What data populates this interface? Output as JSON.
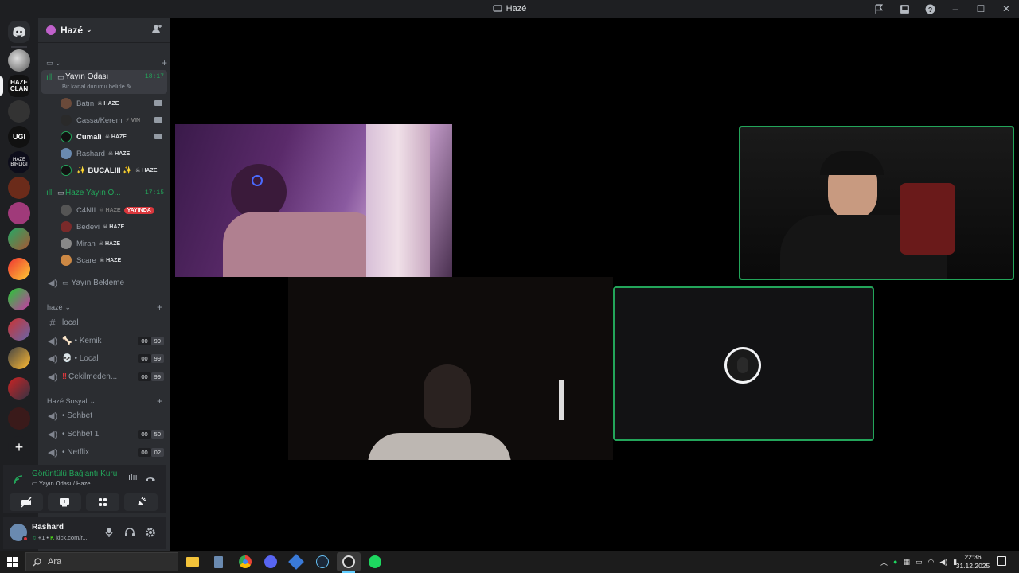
{
  "window": {
    "title": "Hazé"
  },
  "guild": {
    "name": "Hazé"
  },
  "channels": {
    "stream_room": {
      "name": "Yayın Odası",
      "status": "Bir kanal durumu belirle",
      "time": "18:17"
    },
    "members1": [
      {
        "name": "Batın",
        "tag": "HAZE"
      },
      {
        "name": "Cassa/Kerem",
        "tag": "VIN"
      },
      {
        "name": "Cumali",
        "tag": "HAZE"
      },
      {
        "name": "Rashard",
        "tag": "HAZE"
      },
      {
        "name": "✨ BUCALIII ✨",
        "tag": "HAZE"
      }
    ],
    "stream_room2": {
      "name": "Haze Yayın O...",
      "time": "17:15"
    },
    "members2": [
      {
        "name": "C4NII",
        "tag": "HAZE",
        "live": "YAYINDA"
      },
      {
        "name": "Bedevi",
        "tag": "HAZE"
      },
      {
        "name": "Miran",
        "tag": "HAZE"
      },
      {
        "name": "Scare",
        "tag": "HAZE"
      }
    ],
    "waiting": "Yayın Bekleme",
    "cat_haze": "hazé",
    "text_local": "local",
    "voice": [
      {
        "name": "• Kemik",
        "a": "00",
        "b": "99"
      },
      {
        "name": "• Local",
        "a": "00",
        "b": "99"
      },
      {
        "name": "Çekilmeden...",
        "a": "00",
        "b": "99"
      }
    ],
    "cat_social": "Hazé Sosyal",
    "social": [
      {
        "name": "• Sohbet"
      },
      {
        "name": "• Sohbet 1",
        "a": "00",
        "b": "50"
      },
      {
        "name": "• Netflix",
        "a": "00",
        "b": "02"
      }
    ]
  },
  "voice_panel": {
    "status": "Görüntülü Bağlantı Kuru",
    "location": "Yayın Odası / Haze"
  },
  "user": {
    "name": "Rashard",
    "activity": "kick.com/r..."
  },
  "taskbar": {
    "search": "Ara",
    "time": "22:36",
    "date": "31.12.2025"
  },
  "colors": {
    "green": "#23a55a",
    "accent": "#5865f2",
    "live": "#da373c"
  }
}
